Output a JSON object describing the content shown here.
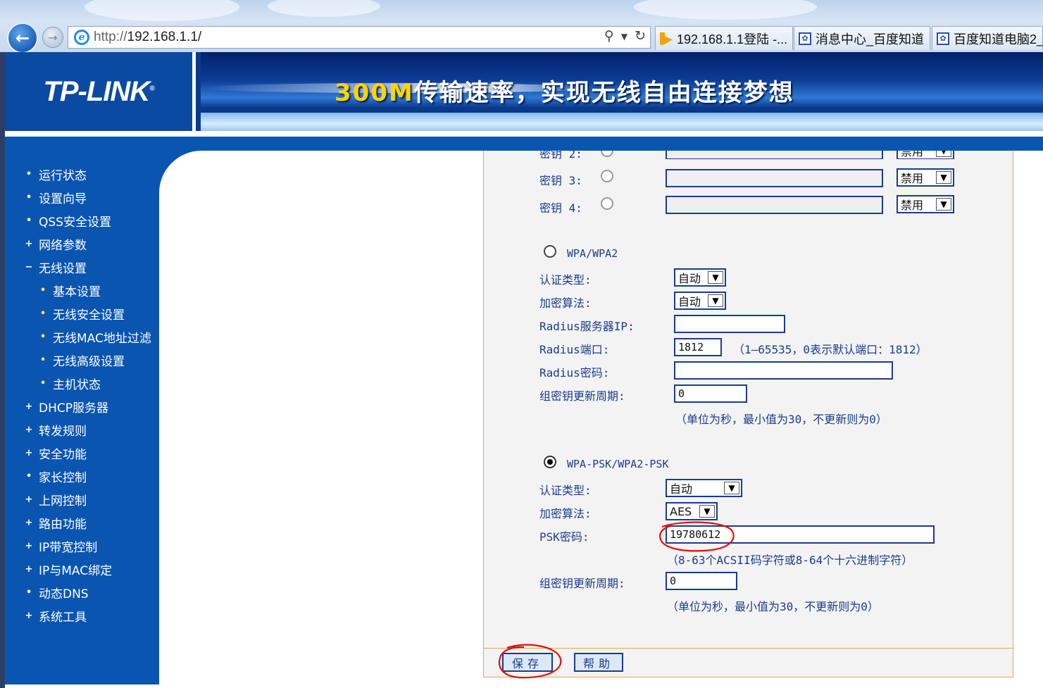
{
  "browser": {
    "address_scheme": "http://",
    "address_host": "192.168.1.1/",
    "tabs": [
      {
        "label": "192.168.1.1登陆 -..."
      },
      {
        "label": "消息中心_百度知道"
      },
      {
        "label": "百度知道电脑2_"
      }
    ]
  },
  "banner": {
    "logo": "TP-LINK",
    "slogan_num": "300M",
    "slogan_text": "传输速率，实现无线自由连接梦想"
  },
  "sidebar": {
    "items": [
      {
        "label": "运行状态",
        "bullet": "•"
      },
      {
        "label": "设置向导",
        "bullet": "•"
      },
      {
        "label": "QSS安全设置",
        "bullet": "•"
      },
      {
        "label": "网络参数",
        "bullet": "+"
      },
      {
        "label": "无线设置",
        "bullet": "−"
      },
      {
        "label": "基本设置",
        "bullet": "•"
      },
      {
        "label": "无线安全设置",
        "bullet": "•"
      },
      {
        "label": "无线MAC地址过滤",
        "bullet": "•"
      },
      {
        "label": "无线高级设置",
        "bullet": "•"
      },
      {
        "label": "主机状态",
        "bullet": "•"
      },
      {
        "label": "DHCP服务器",
        "bullet": "+"
      },
      {
        "label": "转发规则",
        "bullet": "+"
      },
      {
        "label": "安全功能",
        "bullet": "+"
      },
      {
        "label": "家长控制",
        "bullet": "•"
      },
      {
        "label": "上网控制",
        "bullet": "+"
      },
      {
        "label": "路由功能",
        "bullet": "+"
      },
      {
        "label": "IP带宽控制",
        "bullet": "+"
      },
      {
        "label": "IP与MAC绑定",
        "bullet": "+"
      },
      {
        "label": "动态DNS",
        "bullet": "•"
      },
      {
        "label": "系统工具",
        "bullet": "+"
      }
    ]
  },
  "wep": {
    "key2_label": "密钥 2:",
    "key3_label": "密钥 3:",
    "key4_label": "密钥 4:",
    "key2_type": "禁用",
    "key3_type": "禁用",
    "key4_type": "禁用"
  },
  "wpa": {
    "title": "WPA/WPA2",
    "auth_label": "认证类型:",
    "auth_value": "自动",
    "enc_label": "加密算法:",
    "enc_value": "自动",
    "radius_ip_label": "Radius服务器IP:",
    "radius_ip_value": "",
    "radius_port_label": "Radius端口:",
    "radius_port_value": "1812",
    "radius_port_hint": "（1—65535，0表示默认端口：1812）",
    "radius_pwd_label": "Radius密码:",
    "radius_pwd_value": "",
    "group_key_label": "组密钥更新周期:",
    "group_key_value": "0",
    "group_key_hint": "（单位为秒，最小值为30，不更新则为0）"
  },
  "psk": {
    "title": "WPA-PSK/WPA2-PSK",
    "auth_label": "认证类型:",
    "auth_value": "自动",
    "enc_label": "加密算法:",
    "enc_value": "AES",
    "pwd_label": "PSK密码:",
    "pwd_value": "19780612",
    "pwd_hint": "（8-63个ACSII码字符或8-64个十六进制字符）",
    "group_key_label": "组密钥更新周期:",
    "group_key_value": "0",
    "group_key_hint": "（单位为秒，最小值为30，不更新则为0）"
  },
  "buttons": {
    "save": "保存",
    "help": "帮助"
  },
  "colors": {
    "nav_blue": "#0a55b0",
    "label_blue": "#1a3c8c",
    "frame_orange": "#f0a050",
    "annotation_red": "#e01010"
  }
}
